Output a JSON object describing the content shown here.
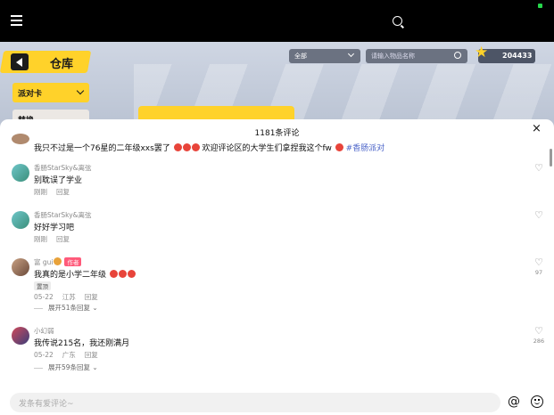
{
  "game": {
    "back_label": "仓库",
    "dropdown_primary": "派对卡",
    "dropdown_secondary": "替换",
    "filter_selected": "全部",
    "search_placeholder": "请输入物品名称",
    "coins": "204433"
  },
  "comments_sheet": {
    "title": "1181条评论",
    "top_comment": {
      "text": "我只不过是一个76星的二年级xxs罢了",
      "text_tail": "欢迎评论区的大学生们拿捏我这个fw",
      "hashtag": "#香肠派对"
    },
    "comments": [
      {
        "user": "香肠StarSky&离弦",
        "text": "别耽误了学业",
        "time": "刚刚",
        "reply": "回复"
      },
      {
        "user": "香肠StarSky&离弦",
        "text": "好好学习吧",
        "time": "刚刚",
        "reply": "回复"
      },
      {
        "user": "富 gui",
        "author_tag": "作者",
        "text": "我真的是小学二年级",
        "pinned": "置顶",
        "time": "05-22",
        "location": "江苏",
        "reply": "回复",
        "likes": "97",
        "expand": "展开51条回复"
      },
      {
        "user": "小幻弱",
        "text": "我传说215名，我还刚满月",
        "time": "05-22",
        "location": "广东",
        "reply": "回复",
        "likes": "286",
        "expand": "展开59条回复"
      }
    ],
    "input_placeholder": "发条有爱评论~"
  },
  "colors": {
    "accent_yellow": "#ffd22a",
    "author_tag": "#ff5a7a",
    "hashtag": "#4a63c8"
  }
}
